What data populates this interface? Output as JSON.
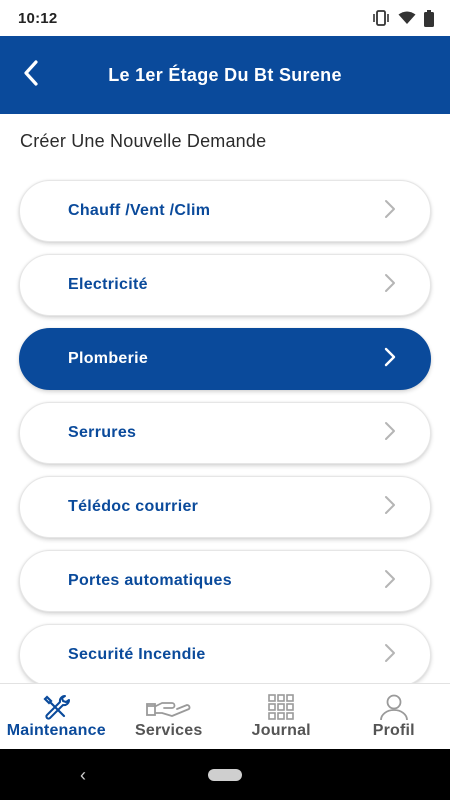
{
  "status_bar": {
    "time": "10:12"
  },
  "header": {
    "title": "Le 1er Étage Du Bt Surene",
    "back_icon": "chevron-left-icon"
  },
  "section": {
    "title": "Créer Une Nouvelle Demande"
  },
  "menu": {
    "items": [
      {
        "label": "Chauff /Vent /Clim",
        "active": false
      },
      {
        "label": "Electricité",
        "active": false
      },
      {
        "label": "Plomberie",
        "active": true
      },
      {
        "label": "Serrures",
        "active": false
      },
      {
        "label": "Télédoc courrier",
        "active": false
      },
      {
        "label": "Portes automatiques",
        "active": false
      },
      {
        "label": "Securité Incendie",
        "active": false
      }
    ]
  },
  "bottom_nav": {
    "items": [
      {
        "label": "Maintenance",
        "icon": "tools-icon",
        "active": true
      },
      {
        "label": "Services",
        "icon": "hand-icon",
        "active": false
      },
      {
        "label": "Journal",
        "icon": "grid-icon",
        "active": false
      },
      {
        "label": "Profil",
        "icon": "person-icon",
        "active": false
      }
    ]
  },
  "colors": {
    "primary": "#0a4a9b",
    "inactive_nav": "#555555",
    "chevron_inactive": "#b5b5b5"
  }
}
